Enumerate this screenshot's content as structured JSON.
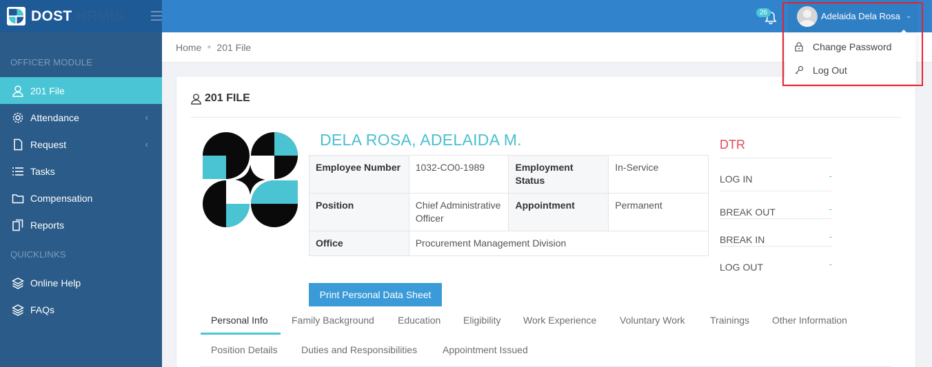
{
  "header": {
    "brand_primary": "DOST",
    "brand_secondary": "HRMIS",
    "notification_count": "26",
    "user_name": "Adelaida Dela Rosa",
    "colors": {
      "bar": "#3184cc",
      "brand_bg": "#1e5a96",
      "accent": "#49c5d5"
    }
  },
  "user_menu": {
    "items": [
      {
        "label": "Change Password",
        "icon": "lock-icon"
      },
      {
        "label": "Log Out",
        "icon": "key-icon"
      }
    ]
  },
  "sidebar": {
    "section_officer": "OFFICER MODULE",
    "section_quicklinks": "QUICKLINKS",
    "items": [
      {
        "label": "201 File",
        "icon": "user-icon",
        "active": true
      },
      {
        "label": "Attendance",
        "icon": "gear-icon",
        "has_submenu": true
      },
      {
        "label": "Request",
        "icon": "file-icon",
        "has_submenu": true
      },
      {
        "label": "Tasks",
        "icon": "list-icon"
      },
      {
        "label": "Compensation",
        "icon": "folder-icon"
      },
      {
        "label": "Reports",
        "icon": "copy-icon"
      }
    ],
    "quicklinks": [
      {
        "label": "Online Help",
        "icon": "layers-icon"
      },
      {
        "label": "FAQs",
        "icon": "layers-icon"
      }
    ]
  },
  "breadcrumb": {
    "home": "Home",
    "current": "201 File"
  },
  "card": {
    "title": "201 FILE",
    "employee_name": "DELA ROSA, ADELAIDA M.",
    "fields": {
      "employee_number_label": "Employee Number",
      "employee_number": "1032-CO0-1989",
      "employment_status_label": "Employment Status",
      "employment_status": "In-Service",
      "position_label": "Position",
      "position": "Chief Administrative Officer",
      "appointment_label": "Appointment",
      "appointment": "Permanent",
      "office_label": "Office",
      "office": "Procurement Management Division"
    },
    "print_button": "Print Personal Data Sheet",
    "dtr": {
      "title": "DTR",
      "rows": [
        {
          "label": "LOG IN",
          "value": "-"
        },
        {
          "label": "BREAK OUT",
          "value": "-"
        },
        {
          "label": "BREAK IN",
          "value": "-"
        },
        {
          "label": "LOG OUT",
          "value": "-"
        }
      ]
    },
    "tabs_row1": [
      "Personal Info",
      "Family Background",
      "Education",
      "Eligibility",
      "Work Experience",
      "Voluntary Work",
      "Trainings",
      "Other Information"
    ],
    "tabs_row2": [
      "Position Details",
      "Duties and Responsibilities",
      "Appointment Issued"
    ]
  }
}
